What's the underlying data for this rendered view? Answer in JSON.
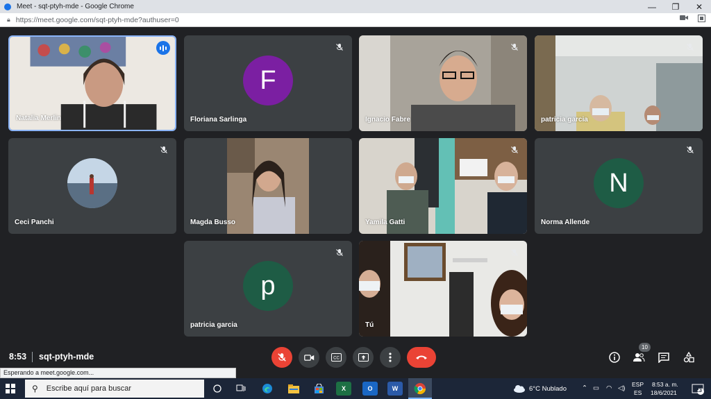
{
  "window": {
    "title": "Meet - sqt-ptyh-mde - Google Chrome",
    "minimize": "—",
    "maximize": "❐",
    "close": "✕"
  },
  "address": {
    "url": "https://meet.google.com/sqt-ptyh-mde?authuser=0"
  },
  "participants": [
    {
      "name": "Natalia Merlin",
      "speaking": true
    },
    {
      "name": "Floriana Sarlinga",
      "initial": "F",
      "avatar_color": "#7b1fa2"
    },
    {
      "name": "Ignacio Fabre"
    },
    {
      "name": "patricia garcia"
    },
    {
      "name": "Ceci Panchi"
    },
    {
      "name": "Magda Busso"
    },
    {
      "name": "Yamila Gatti"
    },
    {
      "name": "Norma Allende",
      "initial": "N",
      "avatar_color": "#1e5c45"
    },
    {
      "name": "patricia garcia",
      "initial": "p",
      "avatar_color": "#1e5c45"
    },
    {
      "name": "Tú"
    }
  ],
  "meeting": {
    "time": "8:53",
    "code": "sqt-ptyh-mde",
    "people_count": "10"
  },
  "status_bar": {
    "text": "Esperando a meet.google.com..."
  },
  "taskbar": {
    "search_placeholder": "Escribe aquí para buscar",
    "weather": "6°C Nublado",
    "lang_top": "ESP",
    "lang_bottom": "ES",
    "time": "8:53 a. m.",
    "date": "18/6/2021",
    "notifications": "23"
  },
  "colors": {
    "background": "#202124",
    "tile": "#3c4043",
    "hangup": "#ea4335",
    "speaking": "#1a73e8",
    "active_border": "#8ab4f8"
  }
}
